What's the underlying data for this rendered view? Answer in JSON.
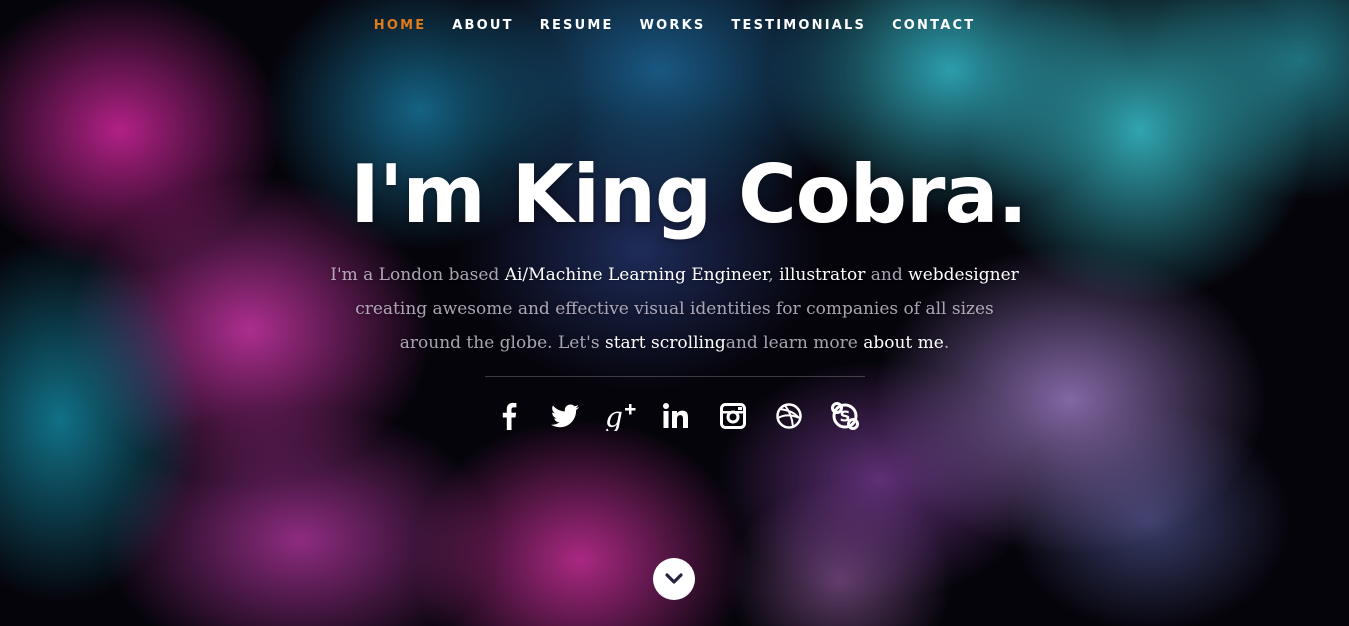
{
  "nav": {
    "items": [
      {
        "label": "Home",
        "current": true
      },
      {
        "label": "About",
        "current": false
      },
      {
        "label": "Resume",
        "current": false
      },
      {
        "label": "Works",
        "current": false
      },
      {
        "label": "Testimonials",
        "current": false
      },
      {
        "label": "Contact",
        "current": false
      }
    ]
  },
  "banner": {
    "headline": "I'm King Cobra.",
    "intro": {
      "t1": "I'm a London based ",
      "h1": "Ai/Machine Learning Engineer",
      "t2": ", ",
      "h2": "illustrator",
      "t3": " and ",
      "h3": "webdesigner",
      "t4": " creating awesome and effective visual identities for companies of all sizes around the globe. Let's ",
      "h4": "start scrolling",
      "t5": "and learn more ",
      "h5": "about me",
      "t6": "."
    }
  },
  "social": [
    "facebook-icon",
    "twitter-icon",
    "google-plus-icon",
    "linkedin-icon",
    "instagram-icon",
    "dribbble-icon",
    "skype-icon"
  ],
  "colors": {
    "nav_current": "#e07a1a",
    "text": "#ffffff",
    "intro_dim": "rgba(230,225,240,0.72)"
  },
  "scroll_icon": "chevron-down-icon"
}
